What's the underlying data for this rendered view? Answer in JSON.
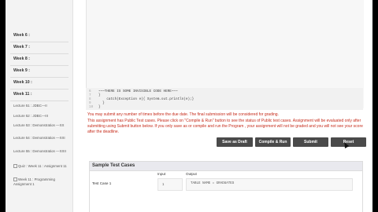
{
  "sidebar": {
    "weeks": [
      "Week 6 :",
      "Week 7 :",
      "Week 8 :",
      "Week 9 :",
      "Week 10 :",
      "Week 11 :"
    ],
    "lectures": [
      "Lecture 51 : JDBC—II",
      "Lecture 52 : JDBC—III",
      "Lecture 53 : Demonstration —XX",
      "Lecture 54 : Demonstration —XXI",
      "Lecture 55 : Demonstration —XXII",
      "Quiz : Week 11 : Assignment 11",
      "Week 11 : Programming Assignment 1"
    ]
  },
  "editor": {
    "lines": [
      {
        "num": "6",
        "text": "~~~THERE IS SOME INVISIBLE CODE HERE~~~"
      },
      {
        "num": "7",
        "text": "}"
      },
      {
        "num": "8",
        "text": "    catch(Exception e){ System.out.println(e);}"
      },
      {
        "num": "9",
        "text": "  }"
      },
      {
        "num": "10",
        "text": "}"
      }
    ]
  },
  "notices": {
    "line1": "You may submit any number of times before the due date. The final submission will be considered for grading.",
    "line2": "This assignment has Public Test cases. Please click on \"Compile & Run\" button to see the status of Public test cases. Assignment will be evaluated only after submitting using Submit button below. If you only save as or compile and run the Program , your assignment will not be graded and you will not see your score after the deadline."
  },
  "buttons": {
    "save_draft": "Save as Draft",
    "compile_run": "Compile & Run",
    "submit": "Submit",
    "reset": "Reset"
  },
  "test_cases": {
    "title": "Sample Test Cases",
    "col_input": "Input",
    "col_output": "Output",
    "rows": [
      {
        "label": "Test Case 1",
        "input": "1",
        "output": "TABLE NAME = GRADUATES"
      }
    ]
  }
}
